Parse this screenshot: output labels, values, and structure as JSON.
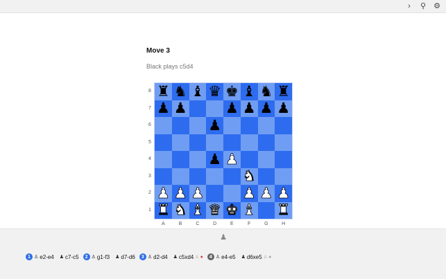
{
  "topbar": {
    "icons": [
      "chevron-right-icon",
      "pin-icon",
      "settings-icon"
    ],
    "glyphs": [
      "›",
      "⚲",
      "⚙"
    ]
  },
  "header": {
    "title": "Move 3",
    "subtitle": "Black plays c5d4"
  },
  "board": {
    "light_color": "#6f9df3",
    "dark_color": "#2e6cef",
    "ranks": [
      "8",
      "7",
      "6",
      "5",
      "4",
      "3",
      "2",
      "1"
    ],
    "files": [
      "A",
      "B",
      "C",
      "D",
      "E",
      "F",
      "G",
      "H"
    ],
    "rows": [
      [
        "bR",
        "bN",
        "bB",
        "bQ",
        "bK",
        "bB",
        "bN",
        "bR"
      ],
      [
        "bP",
        "bP",
        "",
        "",
        "bP",
        "bP",
        "bP",
        "bP"
      ],
      [
        "",
        "",
        "",
        "bP",
        "",
        "",
        "",
        ""
      ],
      [
        "",
        "",
        "",
        "",
        "",
        "",
        "",
        ""
      ],
      [
        "",
        "",
        "",
        "bP",
        "wP",
        "",
        "",
        ""
      ],
      [
        "",
        "",
        "",
        "",
        "",
        "wN",
        "",
        ""
      ],
      [
        "wP",
        "wP",
        "wP",
        "",
        "",
        "wP",
        "wP",
        "wP"
      ],
      [
        "wR",
        "wN",
        "wB",
        "wQ",
        "wK",
        "wB",
        "",
        "wR"
      ]
    ]
  },
  "footer": {
    "pawn_button_glyph": "♟",
    "moves": [
      {
        "num": "1",
        "white": "e2-e4",
        "black": "c7-c5"
      },
      {
        "num": "2",
        "white": "g1-f3",
        "black": "d7-d6"
      },
      {
        "num": "3",
        "white": "d2-d4",
        "black": "c5xd4",
        "marker": "red"
      },
      {
        "num": "4",
        "white": "e4-e5",
        "black": "d6xe5",
        "grey": true
      }
    ]
  }
}
